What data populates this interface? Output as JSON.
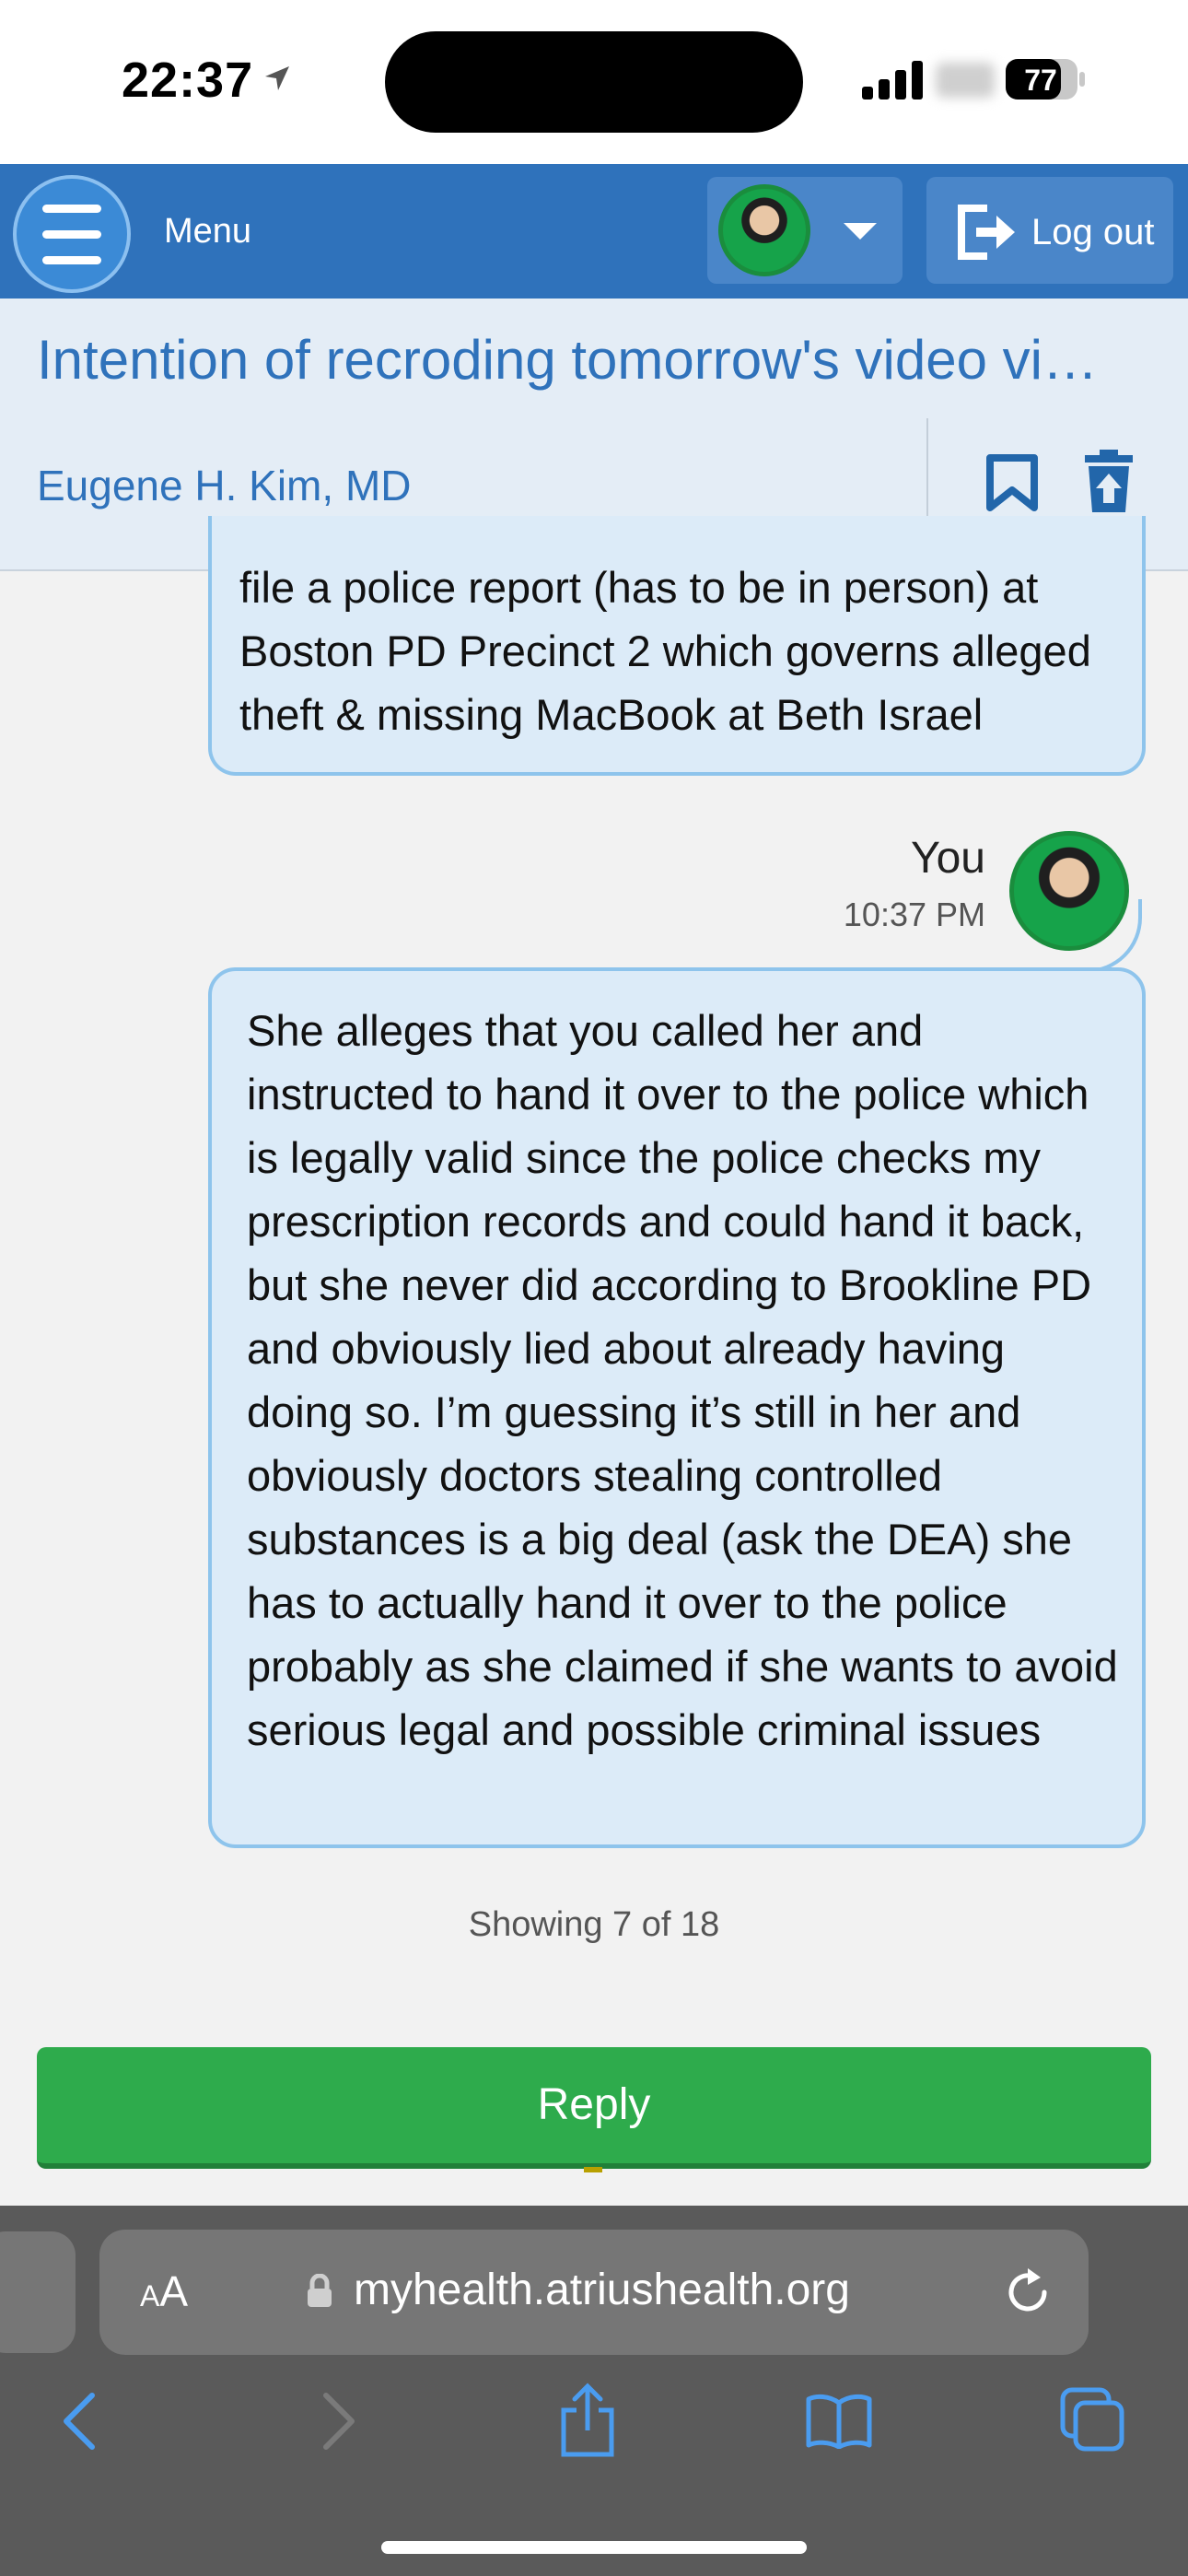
{
  "status_bar": {
    "time": "22:37",
    "battery_level": "77",
    "icons": [
      "location-arrow-icon",
      "signal-bars-icon",
      "battery-icon"
    ]
  },
  "header": {
    "menu_label": "Menu",
    "logout_label": "Log out",
    "colors": {
      "bar": "#2f72bb",
      "button": "#4a86c9"
    }
  },
  "conversation": {
    "subject": "Intention of recroding tomorrow's video vi…",
    "sender": "Eugene H. Kim, MD",
    "messages": [
      {
        "text": "file a police report (has to be in person) at Boston PD Precinct 2 which governs alleged theft & missing MacBook at Beth Israel"
      },
      {
        "sender": "You",
        "time": "10:37 PM",
        "text": "She alleges that you called her and instructed to hand it over to the police which is legally valid since the police checks my prescription records and could hand it back, but she never did according to Brookline PD and obviously lied about already having doing so. I’m guessing it’s still in her and obviously doctors stealing controlled substances is a big deal (ask the DEA) she has to actually hand it over to the police probably as she claimed if she wants to avoid serious legal and possible criminal issues"
      }
    ],
    "showing": "Showing 7 of 18",
    "reply_label": "Reply"
  },
  "browser": {
    "aa_label_small": "A",
    "aa_label_large": "A",
    "url": "myhealth.atriushealth.org"
  }
}
